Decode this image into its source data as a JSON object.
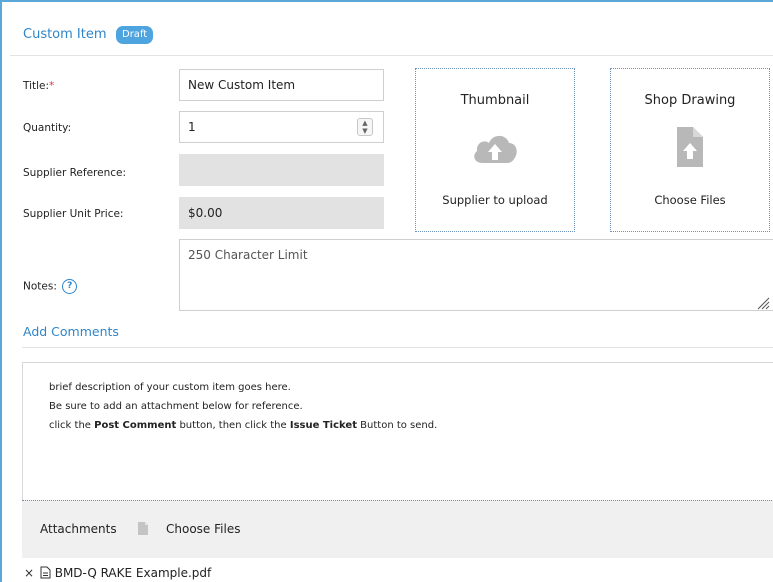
{
  "header": {
    "title": "Custom Item",
    "badge": "Draft"
  },
  "form": {
    "title_label": "Title:",
    "title_required": "*",
    "title_value": "New Custom Item",
    "quantity_label": "Quantity:",
    "quantity_value": "1",
    "supplier_ref_label": "Supplier Reference:",
    "supplier_ref_value": "",
    "supplier_price_label": "Supplier Unit Price:",
    "supplier_price_value": "$0.00",
    "notes_label": "Notes:",
    "notes_placeholder": "250 Character Limit"
  },
  "thumbnail": {
    "title": "Thumbnail",
    "subtitle": "Supplier to upload",
    "icon": "cloud-upload-icon"
  },
  "shop_drawing": {
    "title": "Shop Drawing",
    "subtitle": "Choose Files",
    "icon": "file-upload-icon"
  },
  "comments": {
    "section_title": "Add Comments",
    "line1": "brief description of your custom item goes here.",
    "line2": "Be sure to add an attachment below for reference.",
    "line3_a": "click the ",
    "line3_b": "Post Comment",
    "line3_c": " button, then click the ",
    "line3_d": "Issue Ticket",
    "line3_e": " Button to send."
  },
  "attachments": {
    "label": "Attachments",
    "choose": "Choose Files"
  },
  "files": [
    {
      "remove": "×",
      "name": "BMD-Q RAKE Example.pdf"
    }
  ],
  "colors": {
    "accent": "#2f85c8",
    "badge": "#4ea4de",
    "required": "#e03a3a",
    "disabled_bg": "#e2e2e2"
  }
}
